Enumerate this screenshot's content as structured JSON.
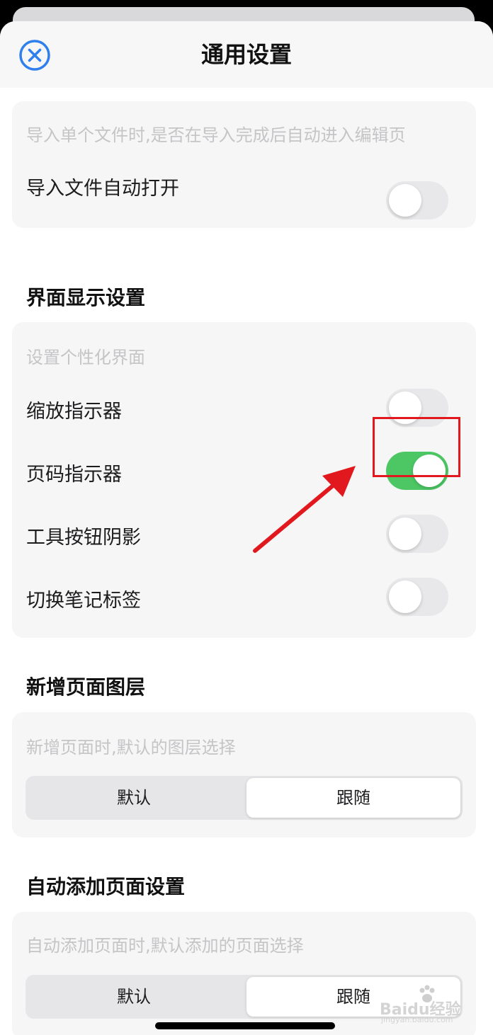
{
  "nav": {
    "title": "通用设置"
  },
  "import_card": {
    "hint": "导入单个文件时,是否在导入完成后自动进入编辑页",
    "label": "导入文件自动打开",
    "on": false
  },
  "display_section": {
    "title": "界面显示设置",
    "hint": "设置个性化界面",
    "rows": [
      {
        "label": "缩放指示器",
        "on": false
      },
      {
        "label": "页码指示器",
        "on": true
      },
      {
        "label": "工具按钮阴影",
        "on": false
      },
      {
        "label": "切换笔记标签",
        "on": false
      }
    ]
  },
  "new_page_section": {
    "title": "新增页面图层",
    "hint": "新增页面时,默认的图层选择",
    "options": [
      "默认",
      "跟随"
    ],
    "selected": "跟随"
  },
  "auto_add_section": {
    "title": "自动添加页面设置",
    "hint": "自动添加页面时,默认添加的页面选择",
    "options": [
      "默认",
      "跟随"
    ],
    "selected": "跟随"
  },
  "watermark": {
    "text": "Baidu经验",
    "sub": "jingyan.baidu.com"
  },
  "colors": {
    "accent_blue": "#2f80ed",
    "toggle_on": "#4cc764",
    "annotation_red": "#e1191e"
  },
  "icons": {
    "close": "close-circle-icon"
  }
}
